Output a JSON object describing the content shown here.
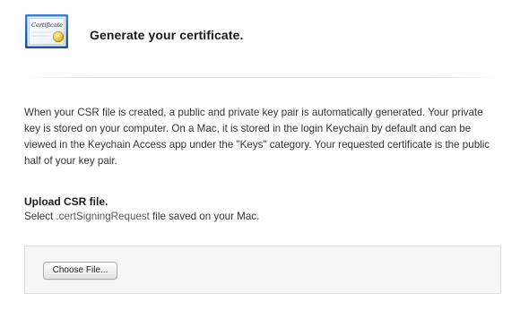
{
  "header": {
    "icon_name": "certificate-icon",
    "icon_text": "Certificate",
    "title": "Generate your certificate."
  },
  "description": "When your CSR file is created, a public and private key pair is automatically generated. Your private key is stored on your computer. On a Mac, it is stored in the login Keychain by default and can be viewed in the Keychain Access app under the \"Keys\" category. Your requested certificate is the public half of your key pair.",
  "upload": {
    "heading": "Upload CSR file.",
    "instruction_prefix": "Select ",
    "file_extension": ".certSigningRequest",
    "instruction_suffix": " file saved on your Mac.",
    "button_label": "Choose File..."
  },
  "colors": {
    "icon_frame": "#1f5fb4",
    "seal": "#d8b93a",
    "upload_box_bg": "#f6f6f6"
  }
}
